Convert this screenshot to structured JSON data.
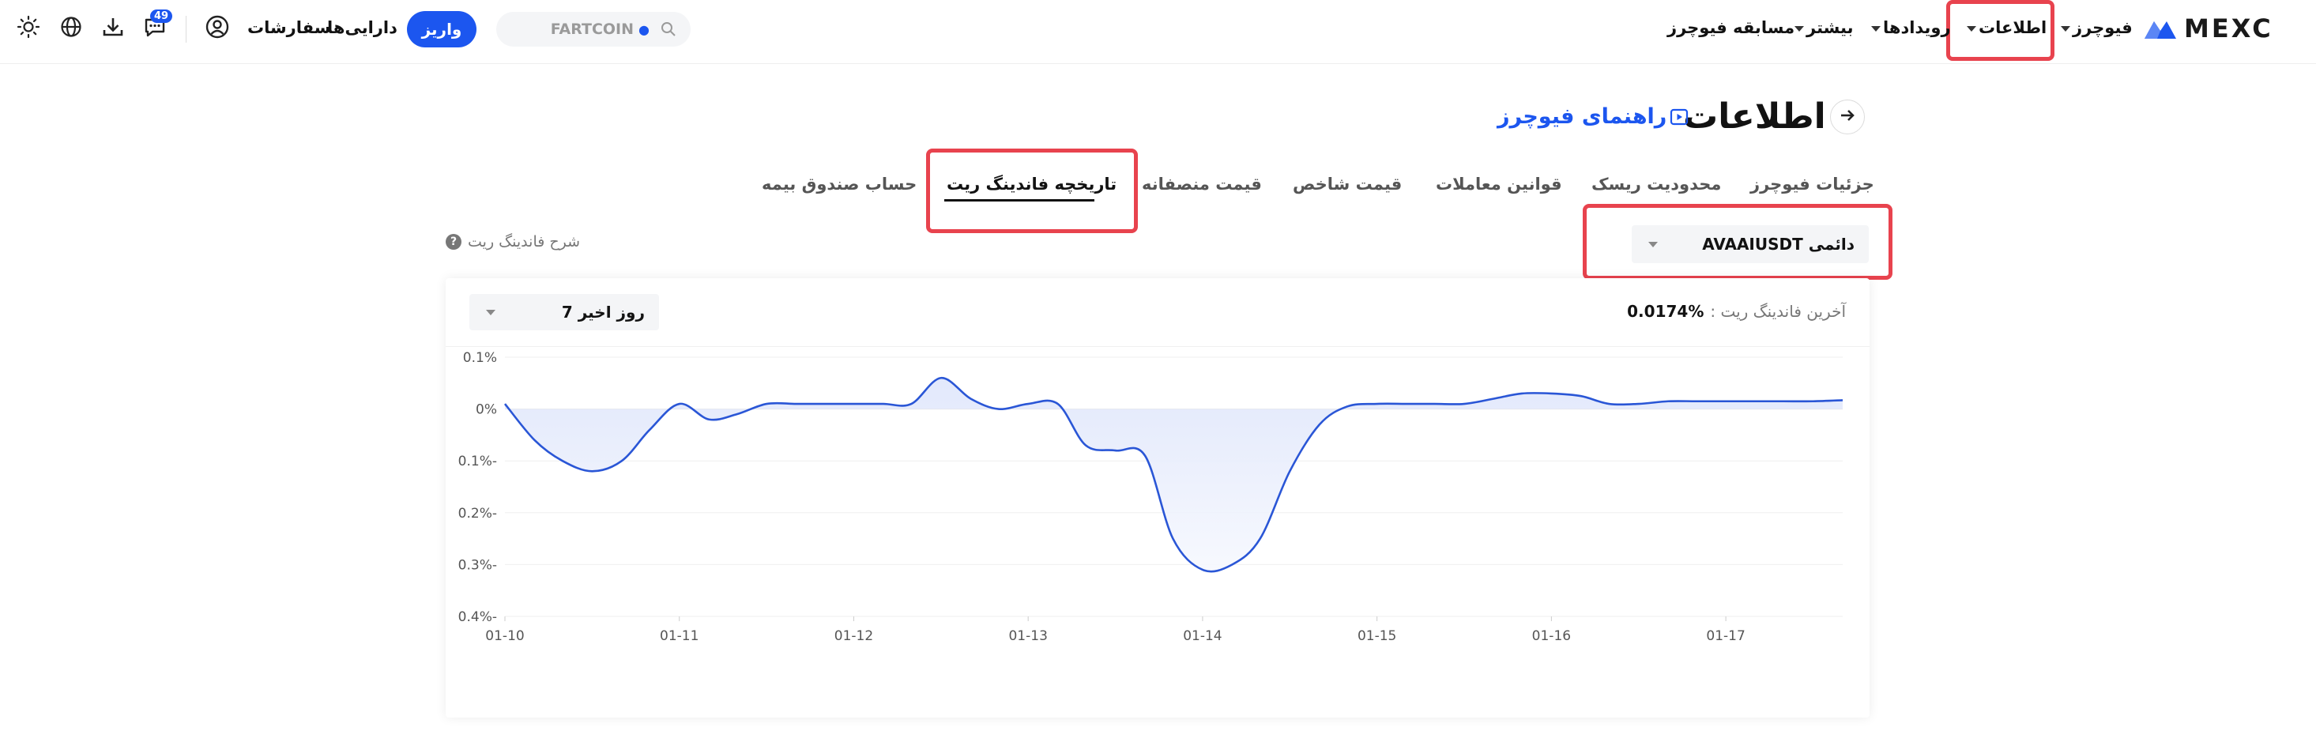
{
  "header": {
    "brand": "MEXC",
    "nav": [
      {
        "label": "فیوچرز",
        "dropdown": true
      },
      {
        "label": "اطلاعات",
        "dropdown": true
      },
      {
        "label": "رویدادها",
        "dropdown": true
      },
      {
        "label": "بیشتر",
        "dropdown": true
      },
      {
        "label": "مسابقه فیوچرز",
        "dropdown": false
      }
    ],
    "search": {
      "placeholder": "FARTCOIN"
    },
    "deposit_label": "واریز",
    "assets_label": "دارایی‌ها",
    "orders_label": "سفارشات",
    "notification_badge": "49"
  },
  "page": {
    "title": "اطلاعات",
    "guide_link": "راهنمای فیوچرز",
    "tabs": [
      "جزئیات فیوچرز",
      "محدودیت ریسک",
      "قوانین معاملات",
      "قیمت شاخص",
      "قیمت منصفانه",
      "تاریخچه فاندینگ ریت",
      "حساب صندوق بیمه"
    ],
    "active_tab": "تاریخچه فاندینگ ریت",
    "symbol_select": {
      "value": "دائمی AVAAIUSDT"
    },
    "funding_explain": "شرح فاندینگ ریت",
    "latest_funding_label": "آخرین فاندینگ ریت :",
    "latest_funding_value": "0.0174%",
    "period_select": {
      "value": "روز اخیر 7"
    }
  },
  "colors": {
    "accent": "#1c56ef",
    "highlight_box": "#e8434e",
    "line": "#2a56d6",
    "fill": "#dfe6fb"
  },
  "chart_data": {
    "type": "area",
    "y_tick_labels": [
      "0.1%",
      "0%",
      "0.1%-",
      "0.2%-",
      "0.3%-",
      "0.4%-"
    ],
    "y_ticks": [
      0.1,
      0,
      -0.1,
      -0.2,
      -0.3,
      -0.4
    ],
    "ylim": [
      -0.4,
      0.1
    ],
    "x_tick_labels": [
      "01-10",
      "01-11",
      "01-12",
      "01-13",
      "01-14",
      "01-15",
      "01-16",
      "01-17"
    ],
    "x_ticks": [
      0,
      1,
      2,
      3,
      4,
      5,
      6,
      7
    ],
    "xlim": [
      0,
      7.67
    ],
    "grid": true,
    "series": [
      {
        "x": [
          0,
          0.17,
          0.33,
          0.5,
          0.67,
          0.83,
          1.0,
          1.17,
          1.33,
          1.5,
          1.67,
          1.83,
          2.0,
          2.17,
          2.33,
          2.5,
          2.67,
          2.83,
          3.0,
          3.17,
          3.33,
          3.5,
          3.67,
          3.83,
          4.0,
          4.17,
          4.33,
          4.5,
          4.67,
          4.83,
          5.0,
          5.17,
          5.33,
          5.5,
          5.67,
          5.83,
          6.0,
          6.17,
          6.33,
          6.5,
          6.67,
          6.83,
          7.0,
          7.17,
          7.33,
          7.5,
          7.67
        ],
        "y": [
          0.01,
          -0.06,
          -0.1,
          -0.12,
          -0.1,
          -0.04,
          0.01,
          -0.02,
          -0.01,
          0.01,
          0.01,
          0.01,
          0.01,
          0.01,
          0.01,
          0.06,
          0.02,
          0.0,
          0.01,
          0.01,
          -0.07,
          -0.08,
          -0.09,
          -0.25,
          -0.31,
          -0.3,
          -0.25,
          -0.12,
          -0.03,
          0.005,
          0.01,
          0.01,
          0.01,
          0.01,
          0.02,
          0.03,
          0.03,
          0.025,
          0.01,
          0.01,
          0.015,
          0.015,
          0.015,
          0.015,
          0.015,
          0.015,
          0.017
        ]
      }
    ]
  }
}
